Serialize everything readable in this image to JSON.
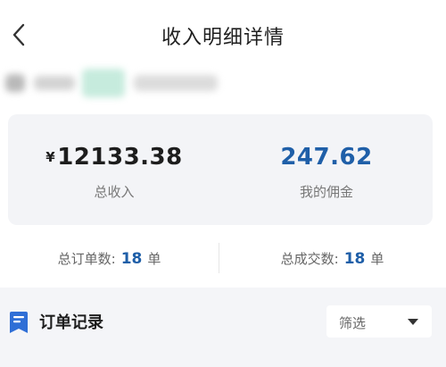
{
  "header": {
    "title": "收入明细详情",
    "back_icon": "chevron-left-icon"
  },
  "summary": {
    "total_income": {
      "currency": "¥",
      "amount": "12133.38",
      "label": "总收入"
    },
    "my_commission": {
      "amount": "247.62",
      "label": "我的佣金"
    }
  },
  "counts": {
    "orders": {
      "label": "总订单数:",
      "value": "18",
      "unit": "单"
    },
    "deals": {
      "label": "总成交数:",
      "value": "18",
      "unit": "单"
    }
  },
  "records": {
    "title": "订单记录",
    "icon": "document-icon",
    "filter": {
      "label": "筛选",
      "icon": "caret-down-icon"
    }
  },
  "colors": {
    "accent_blue": "#1f5fa8",
    "card_bg": "#f3f4f7",
    "icon_blue": "#2f6fd6"
  }
}
